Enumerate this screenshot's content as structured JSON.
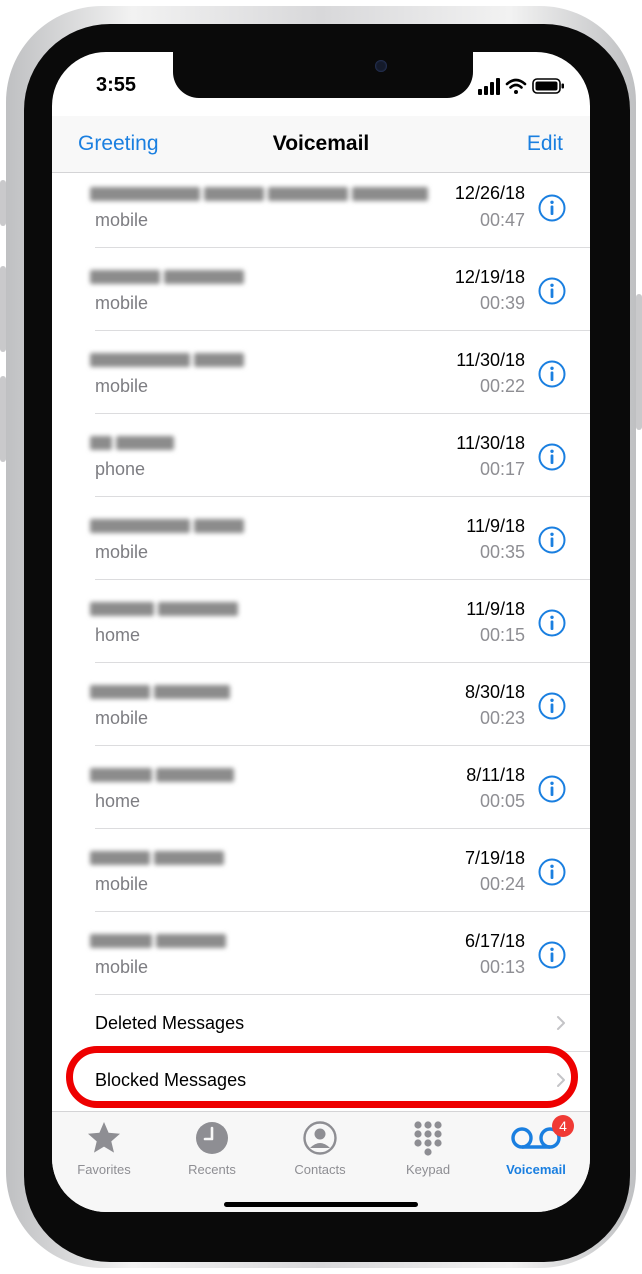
{
  "status": {
    "time": "3:55"
  },
  "nav": {
    "left": "Greeting",
    "title": "Voicemail",
    "right": "Edit"
  },
  "voicemails": [
    {
      "type": "mobile",
      "date": "12/26/18",
      "duration": "00:47"
    },
    {
      "type": "mobile",
      "date": "12/19/18",
      "duration": "00:39"
    },
    {
      "type": "mobile",
      "date": "11/30/18",
      "duration": "00:22"
    },
    {
      "type": "phone",
      "date": "11/30/18",
      "duration": "00:17"
    },
    {
      "type": "mobile",
      "date": "11/9/18",
      "duration": "00:35"
    },
    {
      "type": "home",
      "date": "11/9/18",
      "duration": "00:15"
    },
    {
      "type": "mobile",
      "date": "8/30/18",
      "duration": "00:23"
    },
    {
      "type": "home",
      "date": "8/11/18",
      "duration": "00:05"
    },
    {
      "type": "mobile",
      "date": "7/19/18",
      "duration": "00:24"
    },
    {
      "type": "mobile",
      "date": "6/17/18",
      "duration": "00:13"
    }
  ],
  "footer_rows": {
    "deleted": "Deleted Messages",
    "blocked": "Blocked Messages"
  },
  "tabs": [
    {
      "label": "Favorites",
      "icon": "star-icon"
    },
    {
      "label": "Recents",
      "icon": "clock-icon"
    },
    {
      "label": "Contacts",
      "icon": "person-icon"
    },
    {
      "label": "Keypad",
      "icon": "keypad-icon"
    },
    {
      "label": "Voicemail",
      "icon": "voicemail-icon",
      "active": true,
      "badge": "4"
    }
  ],
  "colors": {
    "accent": "#1a7fe0",
    "annotation": "#ee0000",
    "badge": "#f03a35"
  }
}
